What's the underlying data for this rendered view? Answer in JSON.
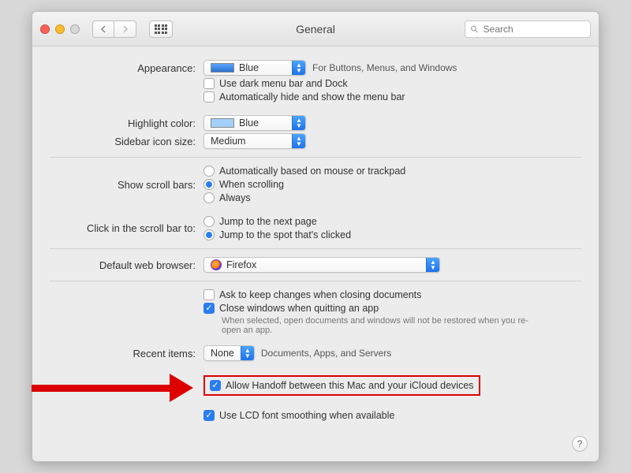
{
  "window": {
    "title": "General"
  },
  "search": {
    "placeholder": "Search"
  },
  "appearance": {
    "label": "Appearance:",
    "value": "Blue",
    "after": "For Buttons, Menus, and Windows",
    "dark_menu_label": "Use dark menu bar and Dock",
    "dark_menu_checked": false,
    "auto_hide_label": "Automatically hide and show the menu bar",
    "auto_hide_checked": false
  },
  "highlight": {
    "label": "Highlight color:",
    "value": "Blue"
  },
  "sidebar": {
    "label": "Sidebar icon size:",
    "value": "Medium"
  },
  "scrollbars": {
    "label": "Show scroll bars:",
    "opt_auto": "Automatically based on mouse or trackpad",
    "opt_scrolling": "When scrolling",
    "opt_always": "Always",
    "selected": "scrolling"
  },
  "click_scroll": {
    "label": "Click in the scroll bar to:",
    "opt_next": "Jump to the next page",
    "opt_spot": "Jump to the spot that's clicked",
    "selected": "spot"
  },
  "browser": {
    "label": "Default web browser:",
    "value": "Firefox"
  },
  "docs": {
    "ask_label": "Ask to keep changes when closing documents",
    "ask_checked": false,
    "close_label": "Close windows when quitting an app",
    "close_checked": true,
    "helper": "When selected, open documents and windows will not be restored when you re-open an app."
  },
  "recent": {
    "label": "Recent items:",
    "value": "None",
    "after": "Documents, Apps, and Servers"
  },
  "handoff": {
    "label": "Allow Handoff between this Mac and your iCloud devices",
    "checked": true
  },
  "lcd": {
    "label": "Use LCD font smoothing when available",
    "checked": true
  }
}
